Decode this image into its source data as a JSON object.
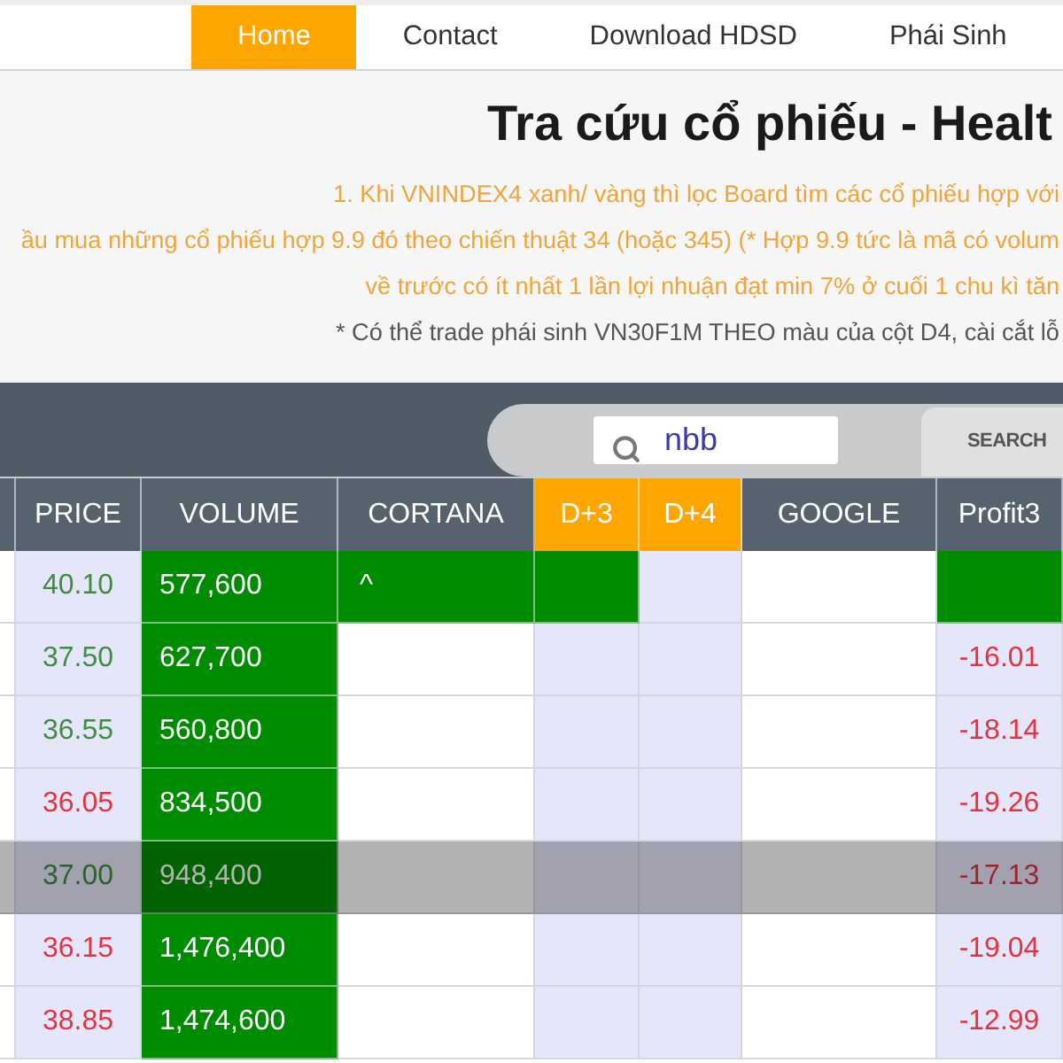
{
  "nav": [
    {
      "label": "Home",
      "selected": true
    },
    {
      "label": "Contact",
      "selected": false
    },
    {
      "label": "Download HDSD",
      "selected": false
    },
    {
      "label": "Phái Sinh",
      "selected": false
    }
  ],
  "title": "Tra cứu cổ phiếu - Healt",
  "notes": [
    {
      "kind": "highlight",
      "text": "1. Khi VNINDEX4 xanh/ vàng thì lọc Board tìm các cổ phiếu hợp với"
    },
    {
      "kind": "highlight",
      "text": "ầu mua những cổ phiếu hợp 9.9 đó theo chiến thuật 34 (hoặc 345) (* Hợp 9.9 tức là mã có volum"
    },
    {
      "kind": "highlight",
      "text": "về trước có ít nhất 1 lần lợi nhuận đạt min 7% ở cuối 1 chu kì tăn"
    },
    {
      "kind": "plain",
      "text": "* Có thể trade phái sinh VN30F1M THEO màu của cột D4, cài cắt lỗ"
    }
  ],
  "search": {
    "value": "nbb",
    "button": "SEARCH"
  },
  "table": {
    "columns": [
      {
        "label": "PRICE",
        "highlighted": false,
        "shaded": true
      },
      {
        "label": "VOLUME",
        "highlighted": false
      },
      {
        "label": "CORTANA",
        "highlighted": false,
        "shaded": false
      },
      {
        "label": "D+3",
        "highlighted": true,
        "shaded": true
      },
      {
        "label": "D+4",
        "highlighted": true,
        "shaded": true
      },
      {
        "label": "GOOGLE",
        "highlighted": false,
        "shaded": false
      },
      {
        "label": "Profit3",
        "highlighted": false,
        "shaded": true
      }
    ],
    "rows": [
      {
        "selected": false,
        "cells": [
          {
            "text": "40.10",
            "rising": true,
            "signal": false
          },
          {
            "text": "577,600",
            "signal": true
          },
          {
            "text": "^",
            "signal": true
          },
          {
            "signal": true
          },
          {
            "signal": false
          },
          {
            "signal": false
          },
          {
            "signal": true
          }
        ]
      },
      {
        "selected": false,
        "cells": [
          {
            "text": "37.50",
            "rising": true,
            "signal": false
          },
          {
            "text": "627,700",
            "signal": true
          },
          {
            "signal": false
          },
          {
            "signal": false
          },
          {
            "signal": false
          },
          {
            "signal": false
          },
          {
            "text": "-16.01",
            "rising": false,
            "signal": false
          }
        ]
      },
      {
        "selected": false,
        "cells": [
          {
            "text": "36.55",
            "rising": true,
            "signal": false
          },
          {
            "text": "560,800",
            "signal": true
          },
          {
            "signal": false
          },
          {
            "signal": false
          },
          {
            "signal": false
          },
          {
            "signal": false
          },
          {
            "text": "-18.14",
            "rising": false,
            "signal": false
          }
        ]
      },
      {
        "selected": false,
        "cells": [
          {
            "text": "36.05",
            "rising": false,
            "signal": false
          },
          {
            "text": "834,500",
            "signal": true
          },
          {
            "signal": false
          },
          {
            "signal": false
          },
          {
            "signal": false
          },
          {
            "signal": false
          },
          {
            "text": "-19.26",
            "rising": false,
            "signal": false
          }
        ]
      },
      {
        "selected": true,
        "cells": [
          {
            "text": "37.00",
            "rising": true,
            "signal": false
          },
          {
            "text": "948,400",
            "signal": true
          },
          {
            "signal": false
          },
          {
            "signal": false
          },
          {
            "signal": false
          },
          {
            "signal": false
          },
          {
            "text": "-17.13",
            "rising": false,
            "signal": false
          }
        ]
      },
      {
        "selected": false,
        "cells": [
          {
            "text": "36.15",
            "rising": false,
            "signal": false
          },
          {
            "text": "1,476,400",
            "signal": true
          },
          {
            "signal": false
          },
          {
            "signal": false
          },
          {
            "signal": false
          },
          {
            "signal": false
          },
          {
            "text": "-19.04",
            "rising": false,
            "signal": false
          }
        ]
      },
      {
        "selected": false,
        "cells": [
          {
            "text": "38.85",
            "rising": false,
            "signal": false
          },
          {
            "text": "1,474,600",
            "signal": true
          },
          {
            "signal": false
          },
          {
            "signal": false
          },
          {
            "signal": false
          },
          {
            "signal": false
          },
          {
            "text": "-12.99",
            "rising": false,
            "signal": false
          }
        ]
      }
    ]
  }
}
